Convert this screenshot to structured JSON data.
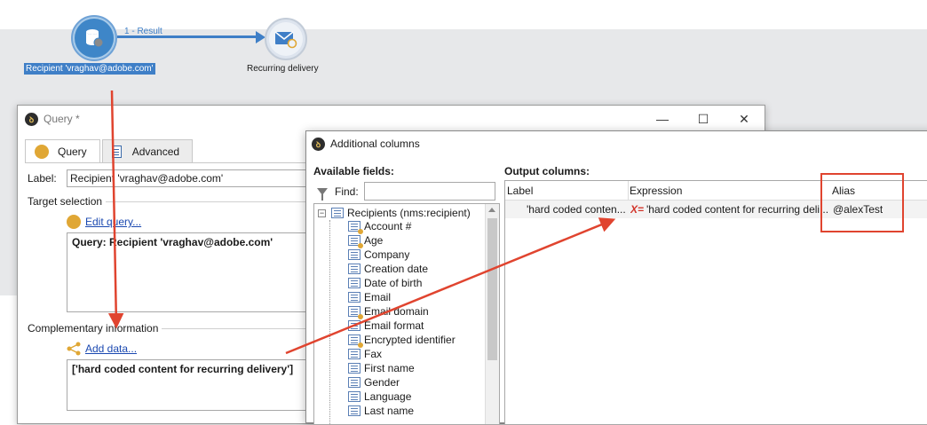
{
  "workflow": {
    "query_node_label": "Recipient 'vraghav@adobe.com'",
    "transition_label": "1 - Result",
    "delivery_node_label": "Recurring delivery"
  },
  "query_window": {
    "title": "Query *",
    "controls": [
      "—",
      "☐",
      "✕"
    ],
    "tabs": [
      {
        "label": "Query",
        "active": true
      },
      {
        "label": "Advanced",
        "active": false
      }
    ],
    "label_field": {
      "label": "Label:",
      "value": "Recipient 'vraghav@adobe.com'"
    },
    "target_selection": {
      "title": "Target selection",
      "link": "Edit query...",
      "content": "Query: Recipient 'vraghav@adobe.com'"
    },
    "complementary": {
      "title": "Complementary information",
      "link": "Add data...",
      "content": "['hard coded content for recurring delivery']"
    }
  },
  "additional_columns_window": {
    "title": "Additional columns",
    "available_fields": {
      "title": "Available fields:",
      "find_label": "Find:",
      "find_value": "",
      "root": "Recipients (nms:recipient)",
      "items": [
        {
          "label": "Account #",
          "icon": "key-list-icon"
        },
        {
          "label": "Age",
          "icon": "key-list-icon"
        },
        {
          "label": "Company",
          "icon": "list-icon"
        },
        {
          "label": "Creation date",
          "icon": "list-icon"
        },
        {
          "label": "Date of birth",
          "icon": "list-icon"
        },
        {
          "label": "Email",
          "icon": "list-icon"
        },
        {
          "label": "Email domain",
          "icon": "key-list-icon"
        },
        {
          "label": "Email format",
          "icon": "list-icon"
        },
        {
          "label": "Encrypted identifier",
          "icon": "key-list-icon"
        },
        {
          "label": "Fax",
          "icon": "list-icon"
        },
        {
          "label": "First name",
          "icon": "list-icon"
        },
        {
          "label": "Gender",
          "icon": "list-icon"
        },
        {
          "label": "Language",
          "icon": "list-icon"
        },
        {
          "label": "Last name",
          "icon": "list-icon"
        }
      ]
    },
    "output_columns": {
      "title": "Output columns:",
      "headers": [
        "Label",
        "Expression",
        "Alias"
      ],
      "rows": [
        {
          "label": "'hard coded conten...",
          "expression_marker": "X=",
          "expression": "'hard coded content for recurring deli...",
          "alias": "@alexTest"
        }
      ]
    }
  },
  "annotation_color": "#e0442f"
}
